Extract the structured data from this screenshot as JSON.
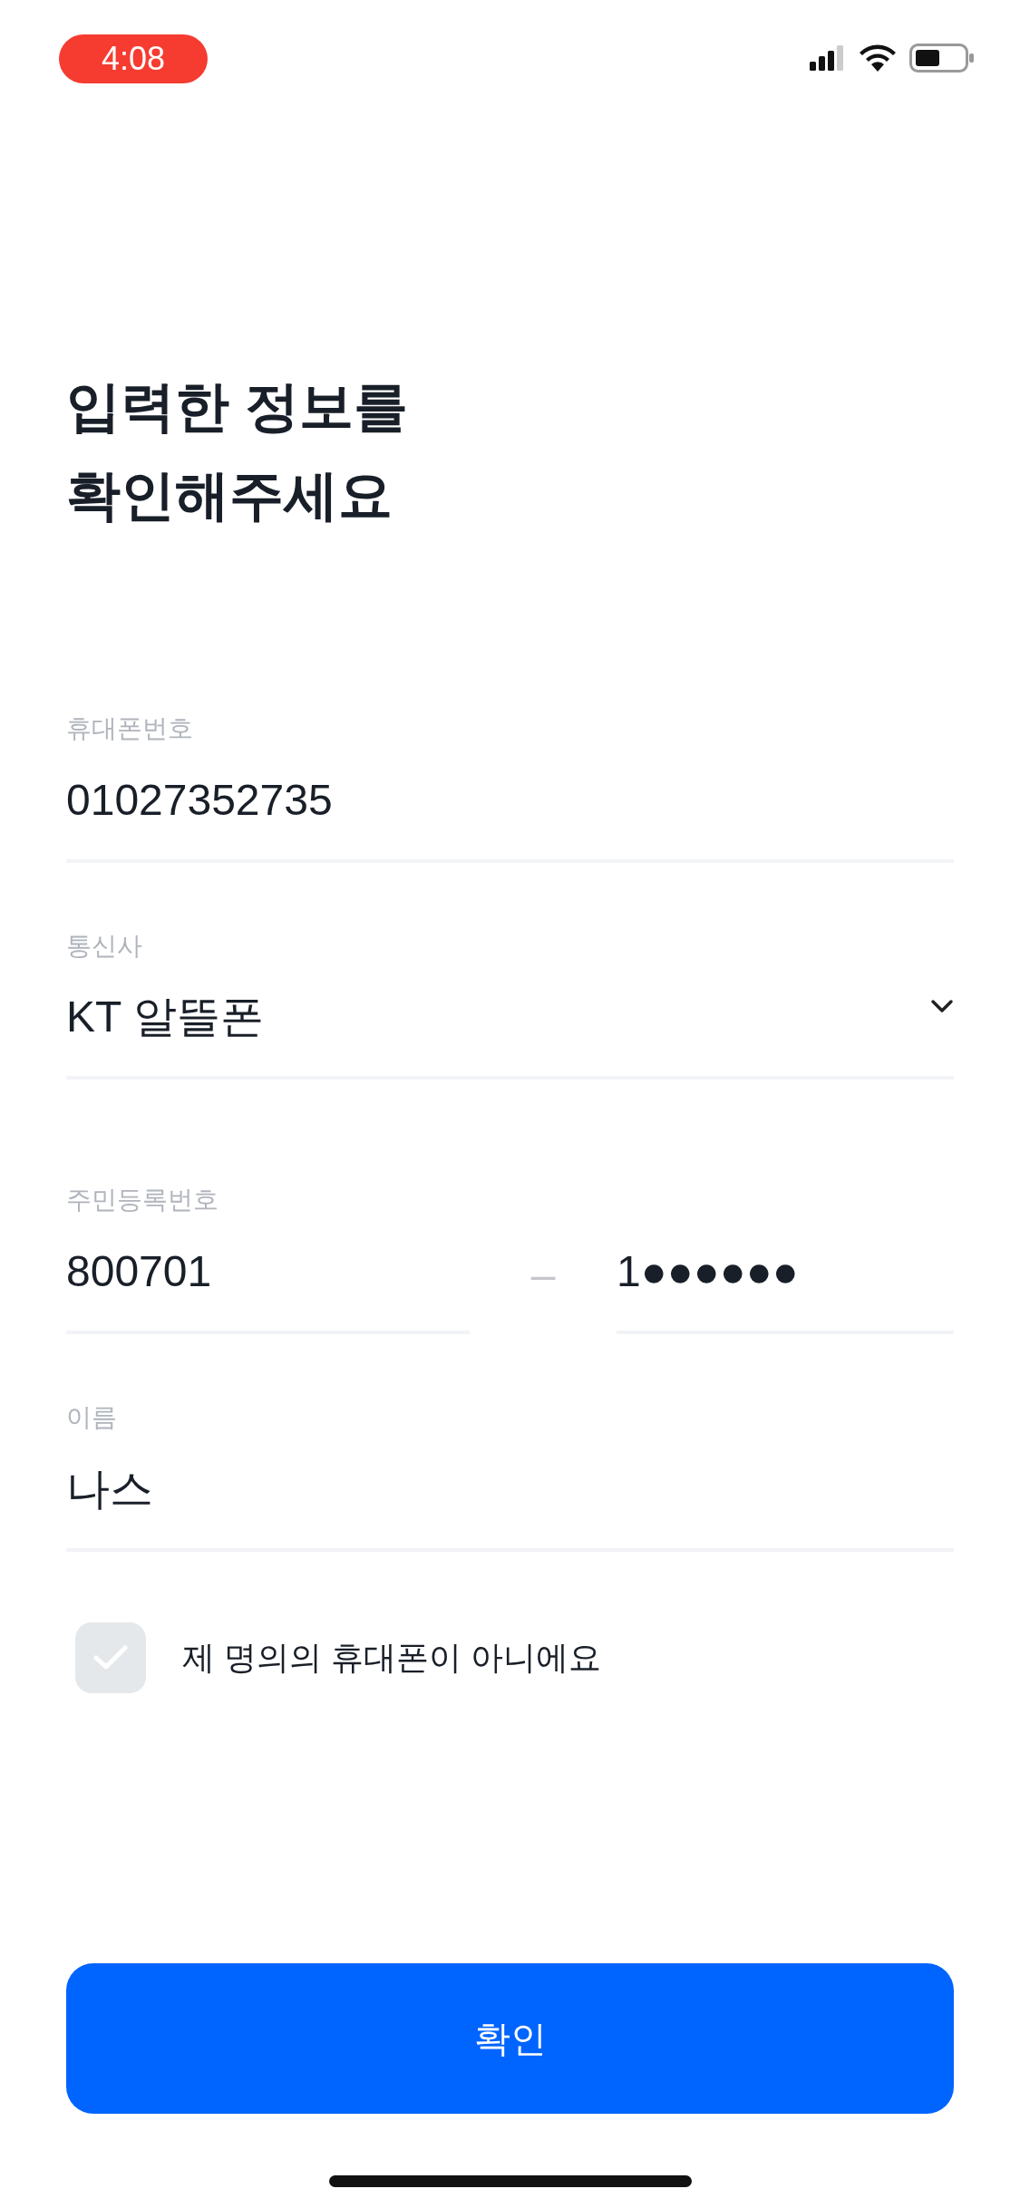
{
  "status_bar": {
    "time": "4:08"
  },
  "title": [
    "입력한 정보를",
    "확인해주세요"
  ],
  "fields": [
    {
      "kind": "text",
      "label": "휴대폰번호",
      "value": "01027352735"
    },
    {
      "kind": "select",
      "label": "통신사",
      "value": "KT 알뜰폰"
    },
    {
      "kind": "split",
      "label": "주민등록번호",
      "value": "800701",
      "separator": "–",
      "second_value": "1●●●●●●"
    },
    {
      "kind": "text",
      "label": "이름",
      "value": "나스"
    }
  ],
  "checkbox": {
    "label": "제 명의의 휴대폰이 아니에요",
    "checked": false
  },
  "button": {
    "label": "확인"
  }
}
